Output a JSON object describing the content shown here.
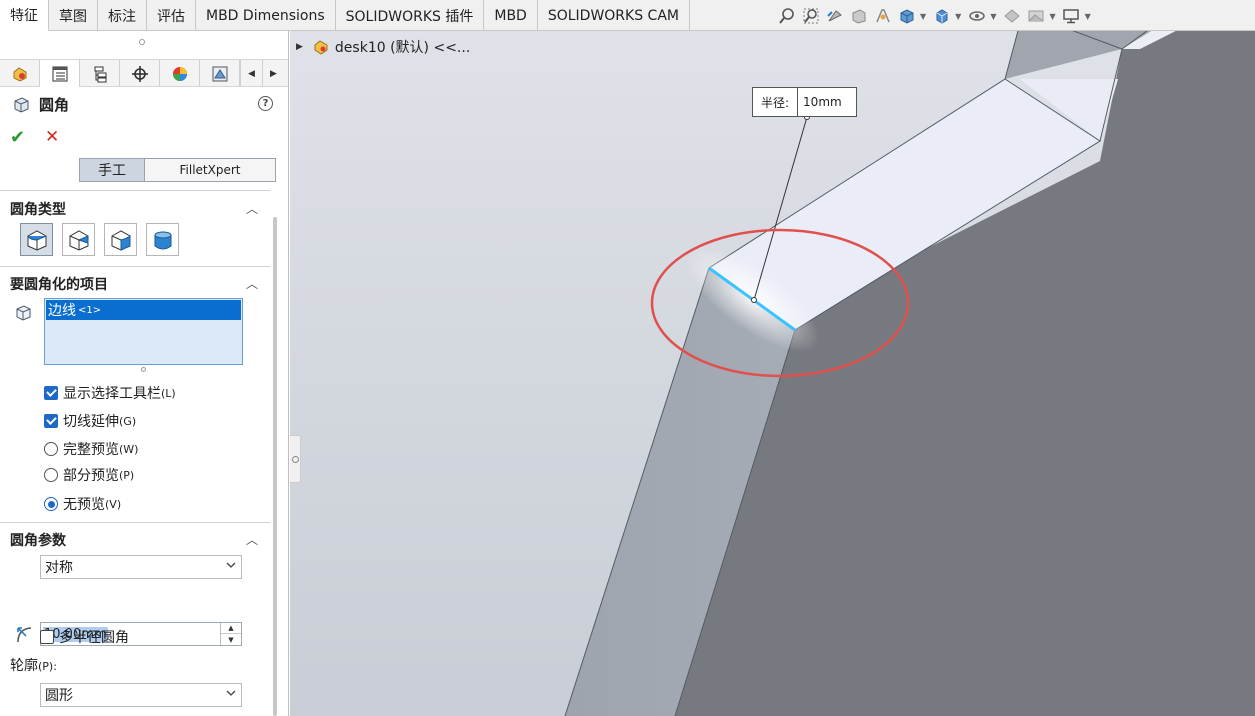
{
  "tabs": [
    {
      "label": "特征",
      "active": true
    },
    {
      "label": "草图",
      "active": false
    },
    {
      "label": "标注",
      "active": false
    },
    {
      "label": "评估",
      "active": false
    },
    {
      "label": "MBD Dimensions",
      "active": false
    },
    {
      "label": "SOLIDWORKS 插件",
      "active": false
    },
    {
      "label": "MBD",
      "active": false
    },
    {
      "label": "SOLIDWORKS CAM",
      "active": false
    }
  ],
  "feature": {
    "title": "圆角",
    "help": "?",
    "ok": "✔",
    "cancel": "✕"
  },
  "modes": {
    "manual": "手工",
    "xpert": "FilletXpert"
  },
  "sections": {
    "fillet_type": "圆角类型",
    "items_to_fillet": "要圆角化的项目",
    "fillet_params": "圆角参数"
  },
  "selection": {
    "item": "边线",
    "count": "<1>"
  },
  "options": [
    {
      "label": "显示选择工具栏",
      "key": "(L)",
      "kind": "checkbox",
      "checked": true
    },
    {
      "label": "切线延伸",
      "key": "(G)",
      "kind": "checkbox",
      "checked": true
    },
    {
      "label": "完整预览",
      "key": "(W)",
      "kind": "radio",
      "checked": false
    },
    {
      "label": "部分预览",
      "key": "(P)",
      "kind": "radio",
      "checked": false
    },
    {
      "label": "无预览",
      "key": "(V)",
      "kind": "radio",
      "checked": true
    }
  ],
  "params": {
    "method": "对称",
    "radius": "10.00mm",
    "multi_radius_label": "多半径圆角",
    "multi_radius_checked": false,
    "profile_label": "轮廓",
    "profile_key": "(P):",
    "profile_value": "圆形"
  },
  "tree": {
    "doc": "desk10 (默认) <<..."
  },
  "callout": {
    "key": "半径:",
    "value": "10mm"
  },
  "colors": {
    "selected_edge": "#39c4ff",
    "highlight_ring": "#e0504c",
    "accent": "#1e69c6"
  }
}
